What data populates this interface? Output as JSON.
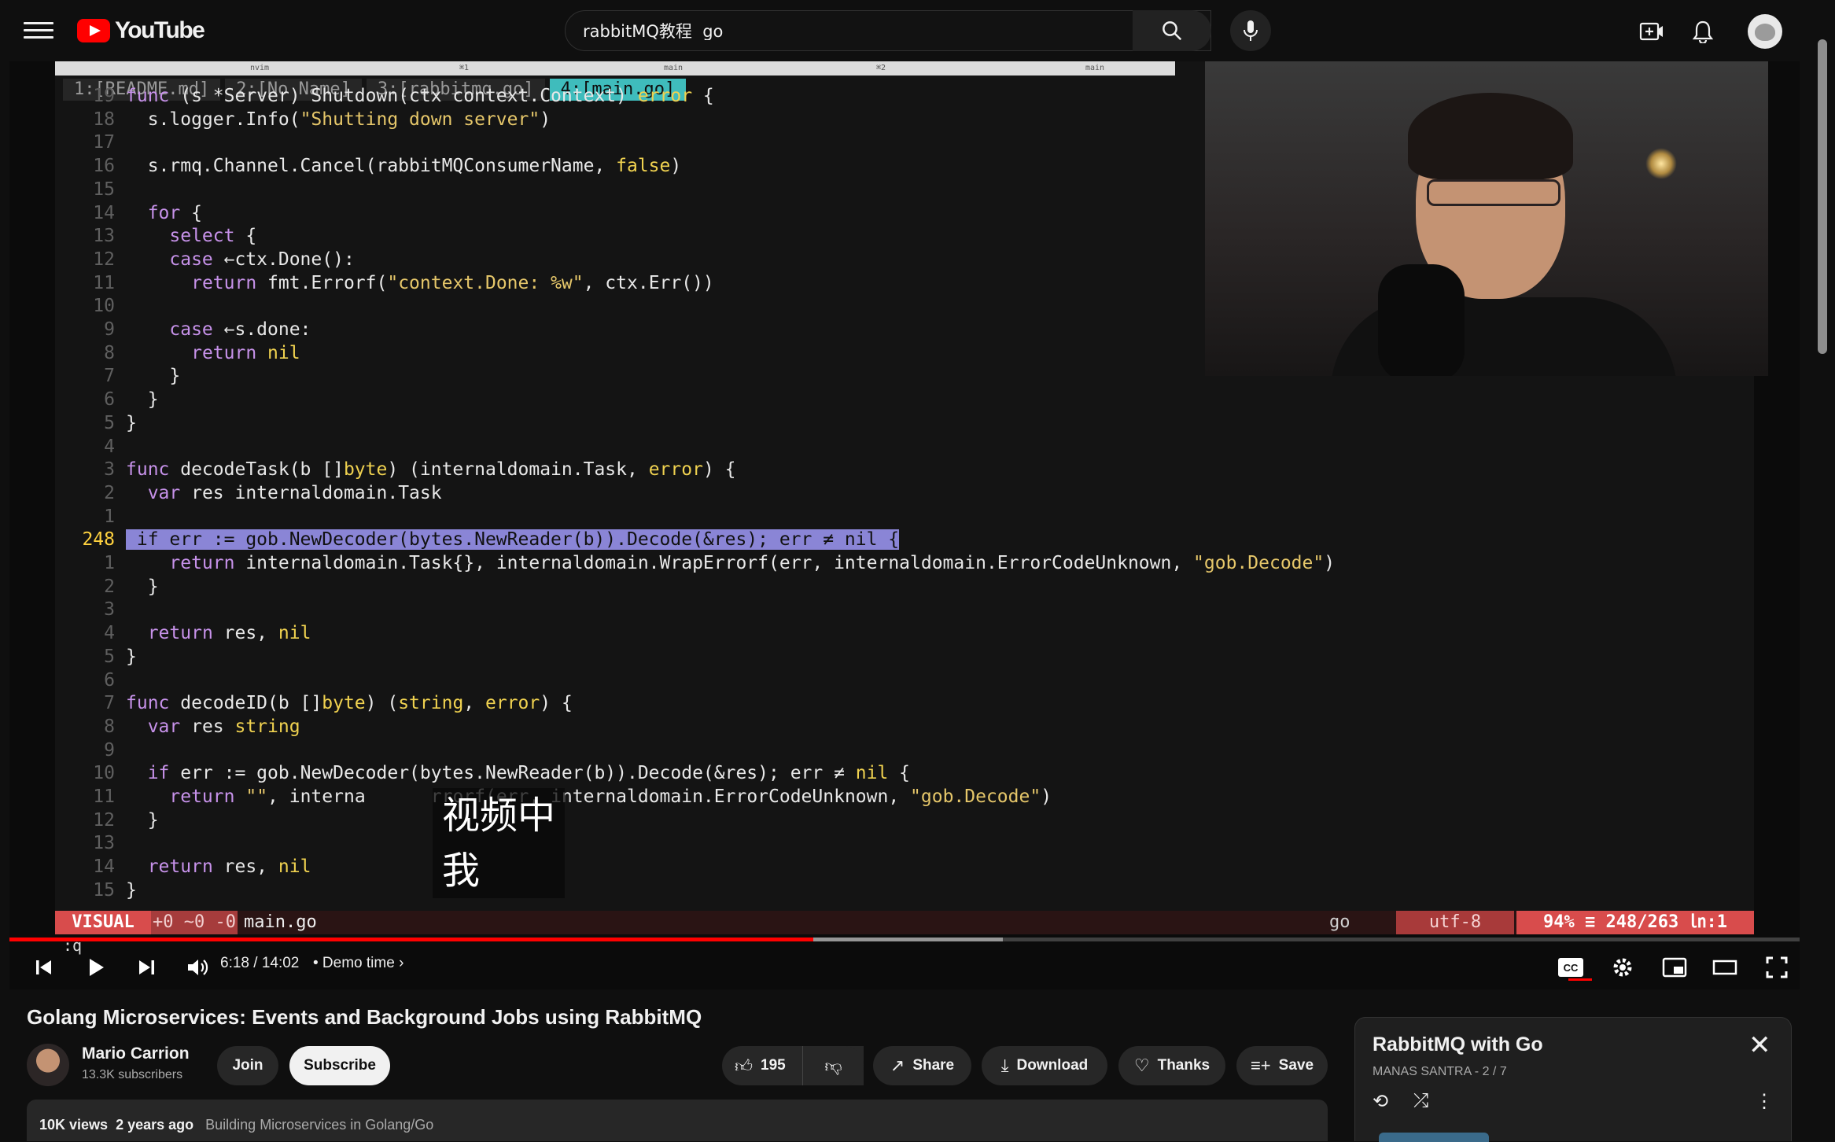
{
  "header": {
    "logo_text": "YouTube",
    "search_value": "rabbitMQ教程  go",
    "icons": [
      "menu-icon",
      "youtube-logo-icon",
      "clear-icon",
      "search-icon",
      "mic-icon",
      "create-icon",
      "bell-icon",
      "avatar-icon"
    ]
  },
  "editor": {
    "tabs": [
      "1:[README.md]",
      "2:[No Name]",
      "3:[rabbitmq.go]",
      "4:[main.go]"
    ],
    "tmux": {
      "left": "nvim",
      "mid1": "main",
      "marker1": "⌘1",
      "marker2": "⌘2",
      "right": "main"
    },
    "mode": "VISUAL",
    "diff": "+0 ~0 -0",
    "filename": "main.go",
    "filetype": "go",
    "encoding": "utf-8",
    "position": "94% ≡ 248/263 ㏑:1",
    "cmdline": ":q"
  },
  "code_lines": [
    {
      "n": "19",
      "t": "func (s *Server) Shutdown(ctx context.Context) error {"
    },
    {
      "n": "18",
      "t": "  s.logger.Info(\"Shutting down server\")"
    },
    {
      "n": "17",
      "t": ""
    },
    {
      "n": "16",
      "t": "  s.rmq.Channel.Cancel(rabbitMQConsumerName, false)"
    },
    {
      "n": "15",
      "t": ""
    },
    {
      "n": "14",
      "t": "  for {"
    },
    {
      "n": "13",
      "t": "    select {"
    },
    {
      "n": "12",
      "t": "    case ←ctx.Done():"
    },
    {
      "n": "11",
      "t": "      return fmt.Errorf(\"context.Done: %w\", ctx.Err())"
    },
    {
      "n": "10",
      "t": ""
    },
    {
      "n": "9",
      "t": "    case ←s.done:"
    },
    {
      "n": "8",
      "t": "      return nil"
    },
    {
      "n": "7",
      "t": "    }"
    },
    {
      "n": "6",
      "t": "  }"
    },
    {
      "n": "5",
      "t": "}"
    },
    {
      "n": "4",
      "t": ""
    },
    {
      "n": "3",
      "t": "func decodeTask(b []byte) (internaldomain.Task, error) {"
    },
    {
      "n": "2",
      "t": "  var res internaldomain.Task"
    },
    {
      "n": "1",
      "t": ""
    },
    {
      "n": "248",
      "t": " if err := gob.NewDecoder(bytes.NewReader(b)).Decode(&res); err ≠ nil {",
      "current": true
    },
    {
      "n": "1",
      "t": "    return internaldomain.Task{}, internaldomain.WrapErrorf(err, internaldomain.ErrorCodeUnknown, \"gob.Decode\")"
    },
    {
      "n": "2",
      "t": "  }"
    },
    {
      "n": "3",
      "t": ""
    },
    {
      "n": "4",
      "t": "  return res, nil"
    },
    {
      "n": "5",
      "t": "}"
    },
    {
      "n": "6",
      "t": ""
    },
    {
      "n": "7",
      "t": "func decodeID(b []byte) (string, error) {"
    },
    {
      "n": "8",
      "t": "  var res string"
    },
    {
      "n": "9",
      "t": ""
    },
    {
      "n": "10",
      "t": "  if err := gob.NewDecoder(bytes.NewReader(b)).Decode(&res); err ≠ nil {"
    },
    {
      "n": "11",
      "t": "    return \"\", interna      rrorf(err, internaldomain.ErrorCodeUnknown, \"gob.Decode\")"
    },
    {
      "n": "12",
      "t": "  }"
    },
    {
      "n": "13",
      "t": ""
    },
    {
      "n": "14",
      "t": "  return res, nil"
    },
    {
      "n": "15",
      "t": "}"
    }
  ],
  "subtitle": {
    "line1": "视频中",
    "line2": "我"
  },
  "player": {
    "time": "6:18 / 14:02",
    "chapter": "• Demo time",
    "progress_played_fraction": 0.449,
    "progress_buffered_fraction": 0.555,
    "icons": [
      "previous-icon",
      "play-icon",
      "next-icon",
      "volume-icon",
      "captions-icon",
      "settings-icon",
      "miniplayer-icon",
      "theater-icon",
      "fullscreen-icon"
    ]
  },
  "video": {
    "title": "Golang Microservices: Events and Background Jobs using RabbitMQ",
    "channel": "Mario Carrion",
    "subscribers": "13.3K subscribers",
    "join": "Join",
    "subscribe": "Subscribe",
    "likes": "195",
    "share": "Share",
    "download": "Download",
    "thanks": "Thanks",
    "save": "Save",
    "views": "10K views",
    "age": "2 years ago",
    "playlist_link": "Building Microservices in Golang/Go"
  },
  "playlist": {
    "title": "RabbitMQ with Go",
    "meta": "MANAS SANTRA - 2 / 7"
  },
  "colors": {
    "accent": "#ff0000",
    "visual_mode": "#d84c4c",
    "selection": "#8a85d6",
    "tab_active": "#3fbcbc"
  }
}
